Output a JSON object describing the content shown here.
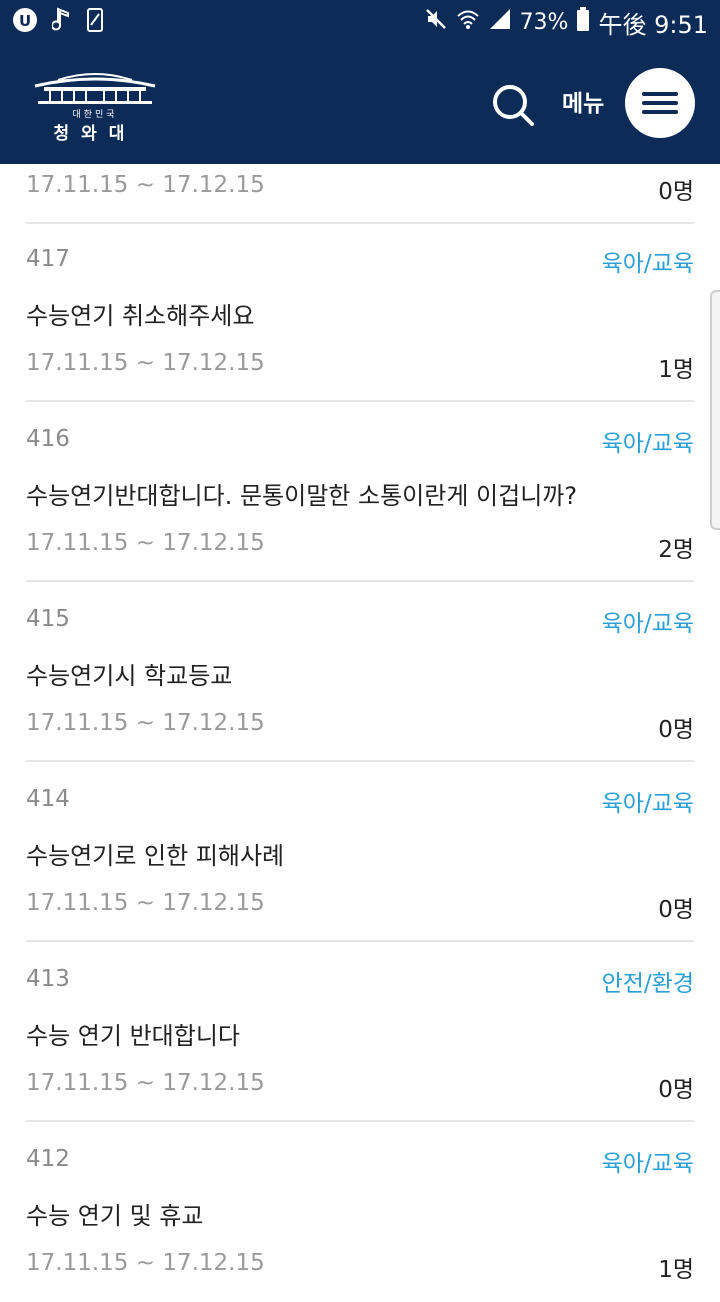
{
  "status_bar": {
    "battery": "73%",
    "time": "午後 9:51",
    "icons": [
      "u-plus-icon",
      "music-note-icon",
      "phone-icon",
      "mute-icon",
      "wifi-icon",
      "signal-icon",
      "battery-icon"
    ]
  },
  "header": {
    "logo_small": "대한민국",
    "logo_name": "청와대",
    "menu_label": "메뉴"
  },
  "top_partial": {
    "date": "17.11.15 ~ 17.12.15",
    "count": "0명"
  },
  "items": [
    {
      "num": "417",
      "category": "육아/교육",
      "title": "수능연기 취소해주세요",
      "date": "17.11.15 ~ 17.12.15",
      "count": "1명"
    },
    {
      "num": "416",
      "category": "육아/교육",
      "title": "수능연기반대합니다. 문통이말한 소통이란게 이겁니까?",
      "date": "17.11.15 ~ 17.12.15",
      "count": "2명"
    },
    {
      "num": "415",
      "category": "육아/교육",
      "title": "수능연기시 학교등교",
      "date": "17.11.15 ~ 17.12.15",
      "count": "0명"
    },
    {
      "num": "414",
      "category": "육아/교육",
      "title": "수능연기로 인한 피해사례",
      "date": "17.11.15 ~ 17.12.15",
      "count": "0명"
    },
    {
      "num": "413",
      "category": "안전/환경",
      "title": "수능 연기 반대합니다",
      "date": "17.11.15 ~ 17.12.15",
      "count": "0명"
    },
    {
      "num": "412",
      "category": "육아/교육",
      "title": "수능 연기 및 휴교",
      "date": "17.11.15 ~ 17.12.15",
      "count": "1명"
    }
  ],
  "colors": {
    "header_bg": "#0c2b57",
    "category": "#2aa0d6"
  }
}
